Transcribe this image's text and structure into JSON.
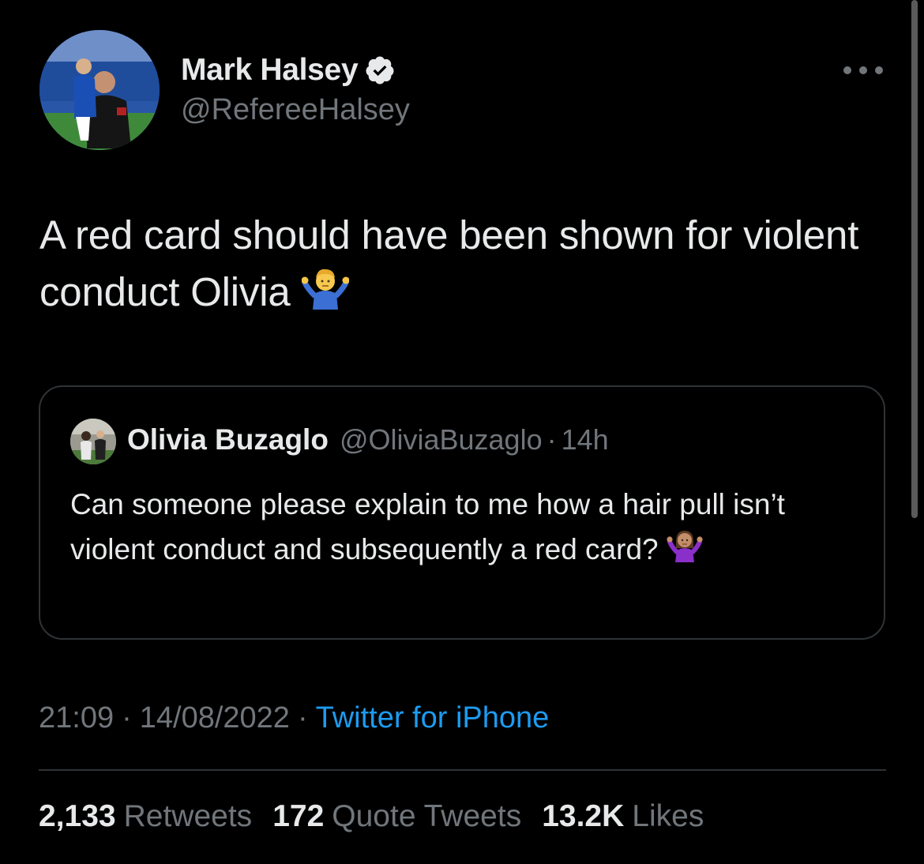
{
  "author": {
    "name": "Mark Halsey",
    "handle": "@RefereeHalsey",
    "verified": true
  },
  "tweet": {
    "text": "A red card should have been shown for violent conduct Olivia",
    "emoji": "person-shrugging"
  },
  "quoted_tweet": {
    "name": "Olivia Buzaglo",
    "handle": "@OliviaBuzaglo",
    "separator": "·",
    "time": "14h",
    "text": "Can someone please explain to me how a hair pull isn’t violent conduct and subsequently a red card?",
    "emoji": "woman-shrugging"
  },
  "meta": {
    "time": "21:09",
    "separator": "·",
    "date": "14/08/2022",
    "source": "Twitter for iPhone"
  },
  "stats": {
    "retweets_count": "2,133",
    "retweets_label": "Retweets",
    "quotes_count": "172",
    "quotes_label": "Quote Tweets",
    "likes_count": "13.2K",
    "likes_label": "Likes"
  },
  "colors": {
    "background": "#000000",
    "text_primary": "#e7e9ea",
    "text_secondary": "#71767b",
    "accent": "#1d9bf0",
    "border": "#2f3336"
  }
}
